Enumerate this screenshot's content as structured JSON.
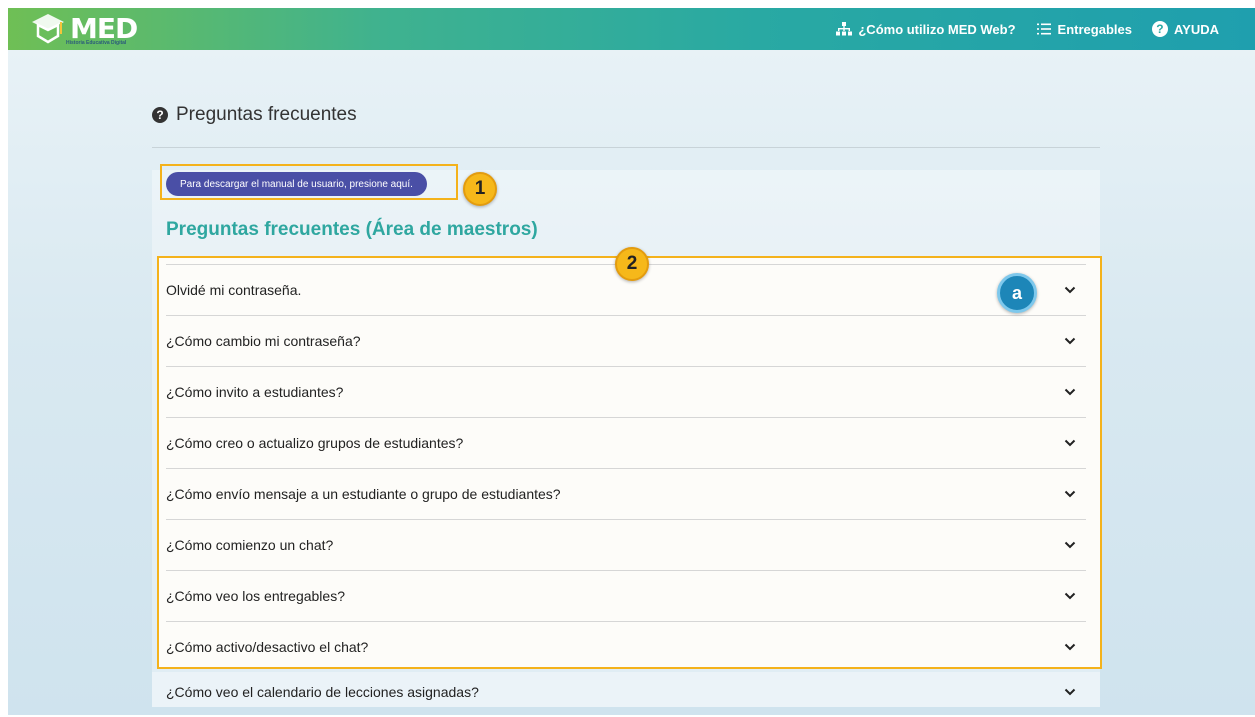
{
  "header": {
    "logo_text": "MED",
    "logo_subtitle": "Historia Educativa Digital",
    "nav": [
      {
        "label": "¿Cómo utilizo MED Web?",
        "icon": "sitemap-icon"
      },
      {
        "label": "Entregables",
        "icon": "list-icon"
      },
      {
        "label": "AYUDA",
        "icon": "help-circle-icon"
      }
    ]
  },
  "page": {
    "title": "Preguntas frecuentes",
    "manual_button": "Para descargar el manual de usuario, presione aquí.",
    "section_heading": "Preguntas frecuentes (Área de maestros)"
  },
  "annotations": {
    "badge_1": "1",
    "badge_2": "2",
    "badge_a": "a"
  },
  "faq": [
    "Olvidé mi contraseña.",
    "¿Cómo cambio mi contraseña?",
    "¿Cómo invito a estudiantes?",
    "¿Cómo creo o actualizo grupos de estudiantes?",
    "¿Cómo envío mensaje a un estudiante o grupo de estudiantes?",
    "¿Cómo comienzo un chat?",
    "¿Cómo veo los entregables?",
    "¿Cómo activo/desactivo el chat?",
    "¿Cómo veo el calendario de lecciones asignadas?"
  ],
  "colors": {
    "accent_teal": "#2fa7a0",
    "button_purple": "#4a4fa6",
    "highlight_orange": "#f4b21b",
    "badge_blue": "#1d86b8"
  }
}
